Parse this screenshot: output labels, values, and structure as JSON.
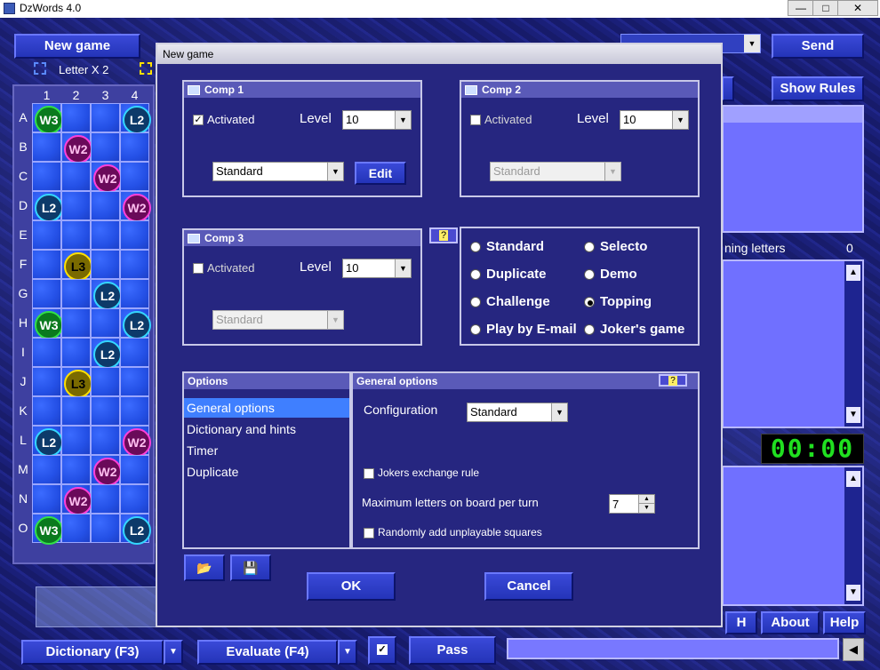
{
  "window": {
    "title": "DzWords 4.0"
  },
  "window_buttons": {
    "minimize": "—",
    "maximize": "□",
    "close": "✕"
  },
  "top": {
    "new_game": "New game",
    "send": "Send",
    "show_rules": "Show Rules",
    "letter_x2": "Letter X 2"
  },
  "board": {
    "columns": [
      "1",
      "2",
      "3",
      "4"
    ],
    "rows": [
      "A",
      "B",
      "C",
      "D",
      "E",
      "F",
      "G",
      "H",
      "I",
      "J",
      "K",
      "L",
      "M",
      "N",
      "O"
    ]
  },
  "right": {
    "remaining_letters_label": "ning letters",
    "remaining_letters_value": "0",
    "timer": "00:00",
    "h_btn": "H",
    "about_btn": "About",
    "help_btn": "Help"
  },
  "bottom": {
    "dictionary": "Dictionary (F3)",
    "evaluate": "Evaluate (F4)",
    "pass": "Pass"
  },
  "dialog": {
    "title": "New game",
    "comp1": {
      "title": "Comp 1",
      "activated": "Activated",
      "checked": true,
      "level_label": "Level",
      "level": "10",
      "style": "Standard",
      "edit": "Edit"
    },
    "comp2": {
      "title": "Comp 2",
      "activated": "Activated",
      "checked": false,
      "level_label": "Level",
      "level": "10",
      "style": "Standard"
    },
    "comp3": {
      "title": "Comp 3",
      "activated": "Activated",
      "checked": false,
      "level_label": "Level",
      "level": "10",
      "style": "Standard"
    },
    "modes": [
      "Standard",
      "Selecto",
      "Duplicate",
      "Demo",
      "Challenge",
      "Topping",
      "Play by E-mail",
      "Joker's game"
    ],
    "selected_mode": "Topping",
    "options_header": "Options",
    "options": [
      "General options",
      "Dictionary and hints",
      "Timer",
      "Duplicate"
    ],
    "selected_option": "General options",
    "general": {
      "header": "General options",
      "configuration_label": "Configuration",
      "configuration": "Standard",
      "jokers_rule": "Jokers exchange rule",
      "max_letters_label": "Maximum letters on board per turn",
      "max_letters": "7",
      "random_squares": "Randomly add unplayable squares"
    },
    "ok": "OK",
    "cancel": "Cancel"
  }
}
